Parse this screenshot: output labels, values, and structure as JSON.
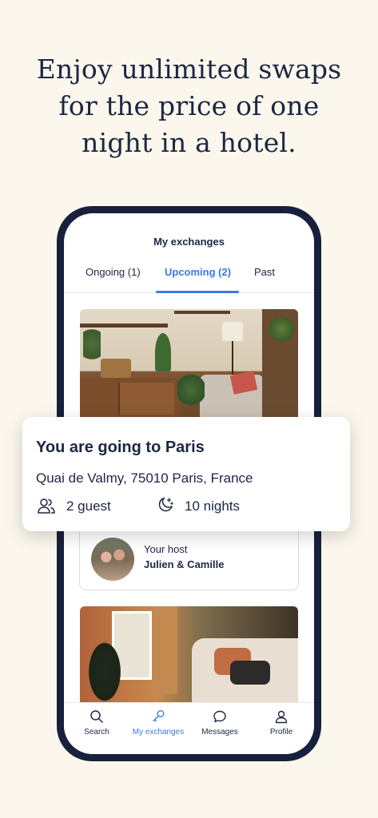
{
  "headline": {
    "line1": "Enjoy unlimited swaps",
    "line2": "for the price of one",
    "line3": "night in a hotel."
  },
  "screen": {
    "title": "My exchanges",
    "tabs": [
      {
        "label": "Ongoing (1)",
        "active": false
      },
      {
        "label": "Upcoming (2)",
        "active": true
      },
      {
        "label": "Past",
        "active": false
      }
    ],
    "accent_color": "#3a7be0",
    "host": {
      "label": "Your host",
      "name": "Julien & Camille"
    }
  },
  "trip_card": {
    "title": "You are going to Paris",
    "address": "Quai de Valmy, 75010 Paris, France",
    "guests": "2 guest",
    "guests_icon": "guests-icon",
    "nights": "10 nights",
    "nights_icon": "moon-stars-icon"
  },
  "nav": {
    "items": [
      {
        "label": "Search",
        "icon": "search-icon",
        "active": false
      },
      {
        "label": "My exchanges",
        "icon": "key-icon",
        "active": true
      },
      {
        "label": "Messages",
        "icon": "chat-bubble-icon",
        "active": false
      },
      {
        "label": "Profile",
        "icon": "user-icon",
        "active": false
      }
    ]
  },
  "colors": {
    "background": "#fcf7ec",
    "navy": "#1c2744",
    "phone_frame": "#17213d"
  }
}
